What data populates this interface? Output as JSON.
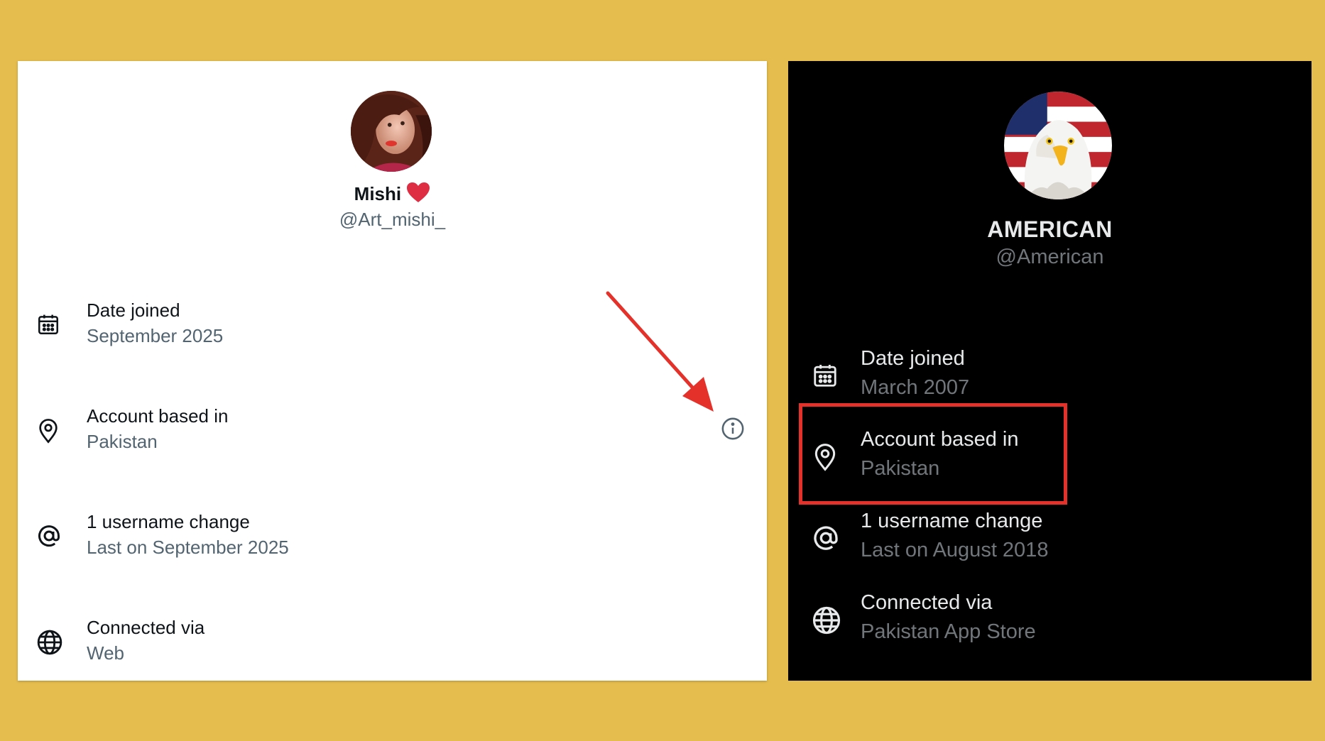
{
  "colors": {
    "background": "#E5BD4E",
    "light_text": "#0f1419",
    "light_secondary": "#536471",
    "dark_text": "#e7e9ea",
    "dark_secondary": "#71767b",
    "annotation_red": "#E4322B",
    "heart": "#F91880"
  },
  "left_profile": {
    "name": "Mishi",
    "name_emoji": "❤️",
    "handle": "@Art_mishi_",
    "rows": [
      {
        "icon": "calendar-icon",
        "label": "Date joined",
        "value": "September 2025"
      },
      {
        "icon": "location-pin-icon",
        "label": "Account based in",
        "value": "Pakistan"
      },
      {
        "icon": "at-sign-icon",
        "label": "1 username change",
        "value": "Last on September 2025"
      },
      {
        "icon": "globe-icon",
        "label": "Connected via",
        "value": "Web"
      }
    ]
  },
  "right_profile": {
    "name": "AMERICAN",
    "handle": "@American",
    "rows": [
      {
        "icon": "calendar-icon",
        "label": "Date joined",
        "value": "March 2007"
      },
      {
        "icon": "location-pin-icon",
        "label": "Account based in",
        "value": "Pakistan"
      },
      {
        "icon": "at-sign-icon",
        "label": "1 username change",
        "value": "Last on August 2018"
      },
      {
        "icon": "globe-icon",
        "label": "Connected via",
        "value": "Pakistan App Store"
      }
    ]
  }
}
